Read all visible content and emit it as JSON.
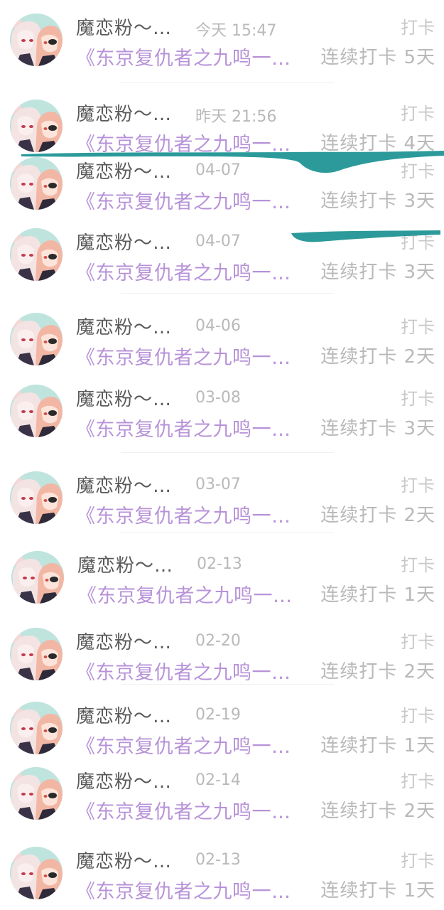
{
  "accent_color": "#b792d8",
  "stroke_color": "#158f8f",
  "avatar_icon": "anime-avatar-icon",
  "items": [
    {
      "name": "魔恋粉～…",
      "time": "今天 15:47",
      "tag": "打卡",
      "title": "《东京复仇者之九鸣一…",
      "streak": "连续打卡 5天"
    },
    {
      "name": "魔恋粉～…",
      "time": "昨天 21:56",
      "tag": "打卡",
      "title": "《东京复仇者之九鸣一…",
      "streak": "连续打卡 4天"
    },
    {
      "name": "魔恋粉～…",
      "time": "04-07",
      "tag": "打卡",
      "title": "《东京复仇者之九鸣一…",
      "streak": "连续打卡 3天"
    },
    {
      "name": "魔恋粉～…",
      "time": "04-07",
      "tag": "打卡",
      "title": "《东京复仇者之九鸣一…",
      "streak": "连续打卡 3天"
    },
    {
      "name": "魔恋粉～…",
      "time": "04-06",
      "tag": "打卡",
      "title": "《东京复仇者之九鸣一…",
      "streak": "连续打卡 2天"
    },
    {
      "name": "魔恋粉～…",
      "time": "03-08",
      "tag": "打卡",
      "title": "《东京复仇者之九鸣一…",
      "streak": "连续打卡 3天"
    },
    {
      "name": "魔恋粉～…",
      "time": "03-07",
      "tag": "打卡",
      "title": "《东京复仇者之九鸣一…",
      "streak": "连续打卡 2天"
    },
    {
      "name": "魔恋粉～…",
      "time": "02-13",
      "tag": "打卡",
      "title": "《东京复仇者之九鸣一…",
      "streak": "连续打卡 1天"
    },
    {
      "name": "魔恋粉～…",
      "time": "02-20",
      "tag": "打卡",
      "title": "《东京复仇者之九鸣一…",
      "streak": "连续打卡 2天"
    },
    {
      "name": "魔恋粉～…",
      "time": "02-19",
      "tag": "打卡",
      "title": "《东京复仇者之九鸣一…",
      "streak": "连续打卡 1天"
    },
    {
      "name": "魔恋粉～…",
      "time": "02-14",
      "tag": "打卡",
      "title": "《东京复仇者之九鸣一…",
      "streak": "连续打卡 2天"
    },
    {
      "name": "魔恋粉～…",
      "time": "02-13",
      "tag": "打卡",
      "title": "《东京复仇者之九鸣一…",
      "streak": "连续打卡 1天"
    }
  ]
}
